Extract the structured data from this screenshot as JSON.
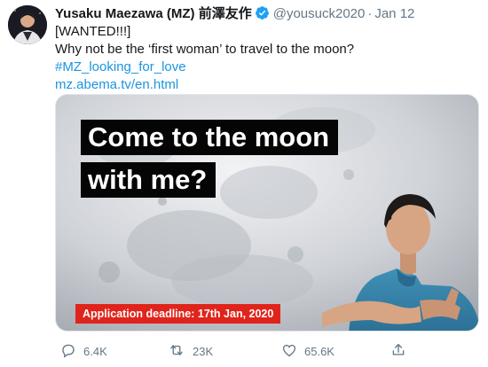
{
  "tweet": {
    "display_name": "Yusaku Maezawa (MZ) 前澤友作",
    "handle": "@yousuck2020",
    "separator": "·",
    "date": "Jan 12",
    "lines": [
      "[WANTED!!!]",
      "Why not be the ‘first woman’ to travel to the moon?"
    ],
    "hashtag": "#MZ_looking_for_love",
    "link": "mz.abema.tv/en.html",
    "media": {
      "headline_line1": "Come to the moon",
      "headline_line2": "with me?",
      "deadline": "Application deadline: 17th Jan, 2020"
    },
    "actions": {
      "reply_count": "6.4K",
      "retweet_count": "23K",
      "like_count": "65.6K"
    }
  },
  "colors": {
    "link": "#1b95e0",
    "muted": "#657786",
    "verified": "#1da1f2",
    "deadline_bg": "#e0241b",
    "headline_bg": "#050505"
  },
  "icons": {
    "verified": "verified-badge-icon",
    "reply": "reply-icon",
    "retweet": "retweet-icon",
    "like": "heart-icon",
    "share": "share-icon"
  }
}
